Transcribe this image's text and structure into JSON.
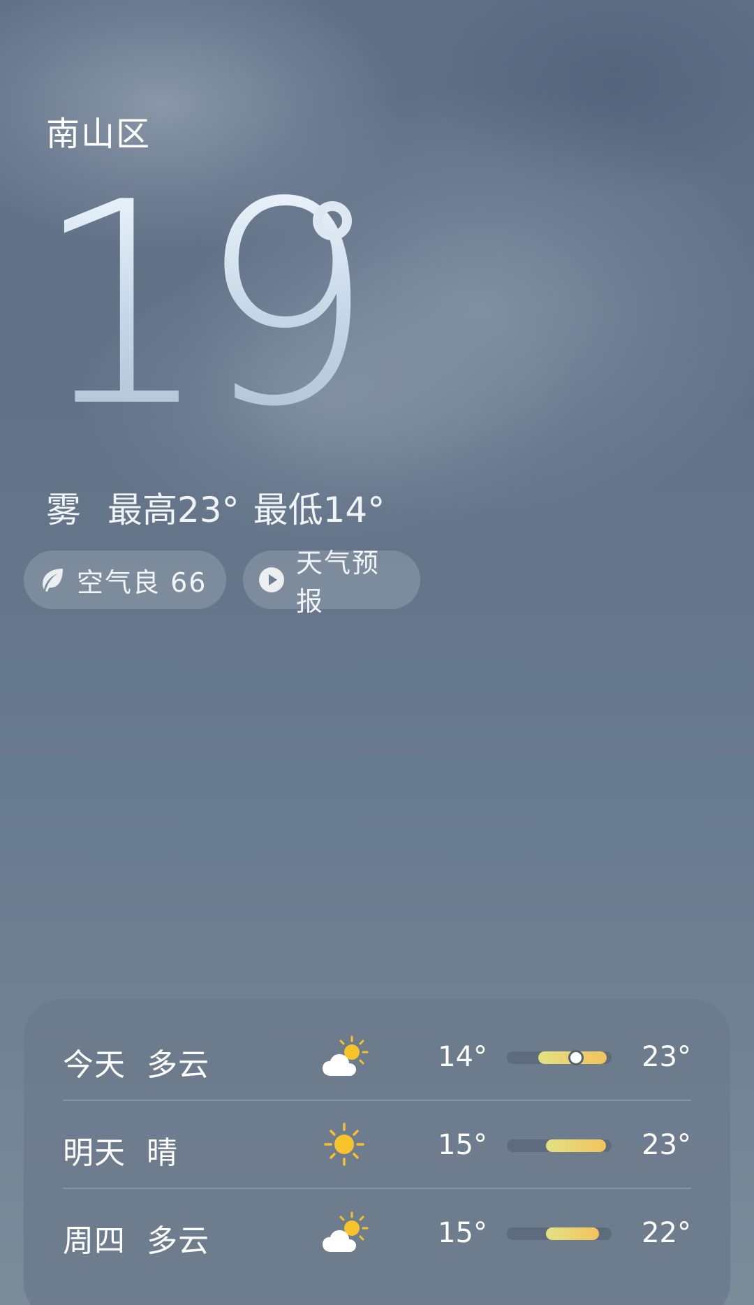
{
  "location": {
    "city": "南山区"
  },
  "current": {
    "temperature": "19",
    "summary": {
      "condition": "雾",
      "high": "最高23°",
      "low": "最低14°"
    }
  },
  "chips": {
    "air_quality": "空气良 66",
    "forecast_video": "天气预报"
  },
  "daily": [
    {
      "day": "今天",
      "condition": "多云",
      "icon": "partly-cloudy-icon",
      "low": "14°",
      "high": "23°",
      "range_min": 14,
      "range_max": 23,
      "current": 19
    },
    {
      "day": "明天",
      "condition": "晴",
      "icon": "sun-icon",
      "low": "15°",
      "high": "23°",
      "range_min": 15,
      "range_max": 23
    },
    {
      "day": "周四",
      "condition": "多云",
      "icon": "partly-cloudy-icon",
      "low": "15°",
      "high": "22°",
      "range_min": 15,
      "range_max": 22
    }
  ],
  "colors": {
    "range_low": "#e3e183",
    "range_high": "#f3c35c",
    "sun": "#f8c22a"
  }
}
